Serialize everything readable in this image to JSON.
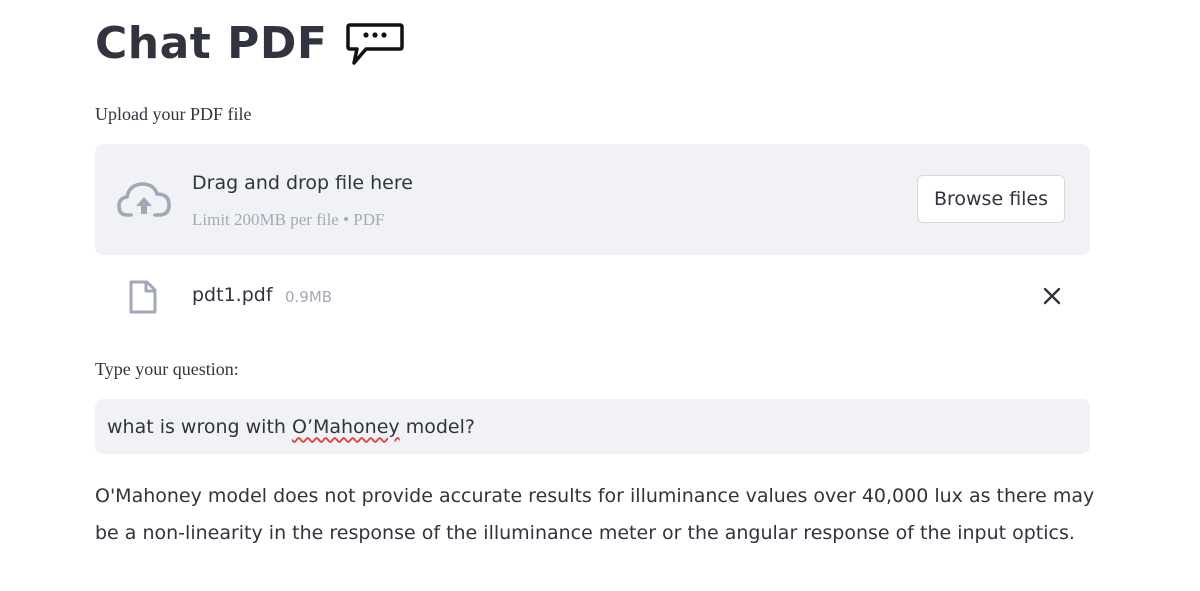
{
  "header": {
    "title": "Chat PDF",
    "title_icon": "speech-bubble-ellipsis-icon"
  },
  "uploader": {
    "label": "Upload your PDF file",
    "dropzone_text": "Drag and drop file here",
    "limit_text": "Limit 200MB per file • PDF",
    "browse_label": "Browse files",
    "icon": "cloud-upload-icon"
  },
  "file": {
    "name": "pdt1.pdf",
    "size": "0.9MB",
    "icon": "file-icon",
    "remove_icon": "close-icon"
  },
  "question": {
    "label": "Type your question:",
    "value_prefix": "what is wrong with ",
    "value_flagged": "O’Mahoney",
    "value_suffix": " model?"
  },
  "answer": {
    "text": "O'Mahoney model does not provide accurate results for illuminance values over 40,000 lux as there may be a non-linearity in the response of the illuminance meter or the angular response of the input optics."
  },
  "colors": {
    "text": "#31333f",
    "muted": "#a3a8b8",
    "panel_bg": "#f0f2f6",
    "icon": "#a3a8b8",
    "spell_underline": "#e0413b"
  }
}
